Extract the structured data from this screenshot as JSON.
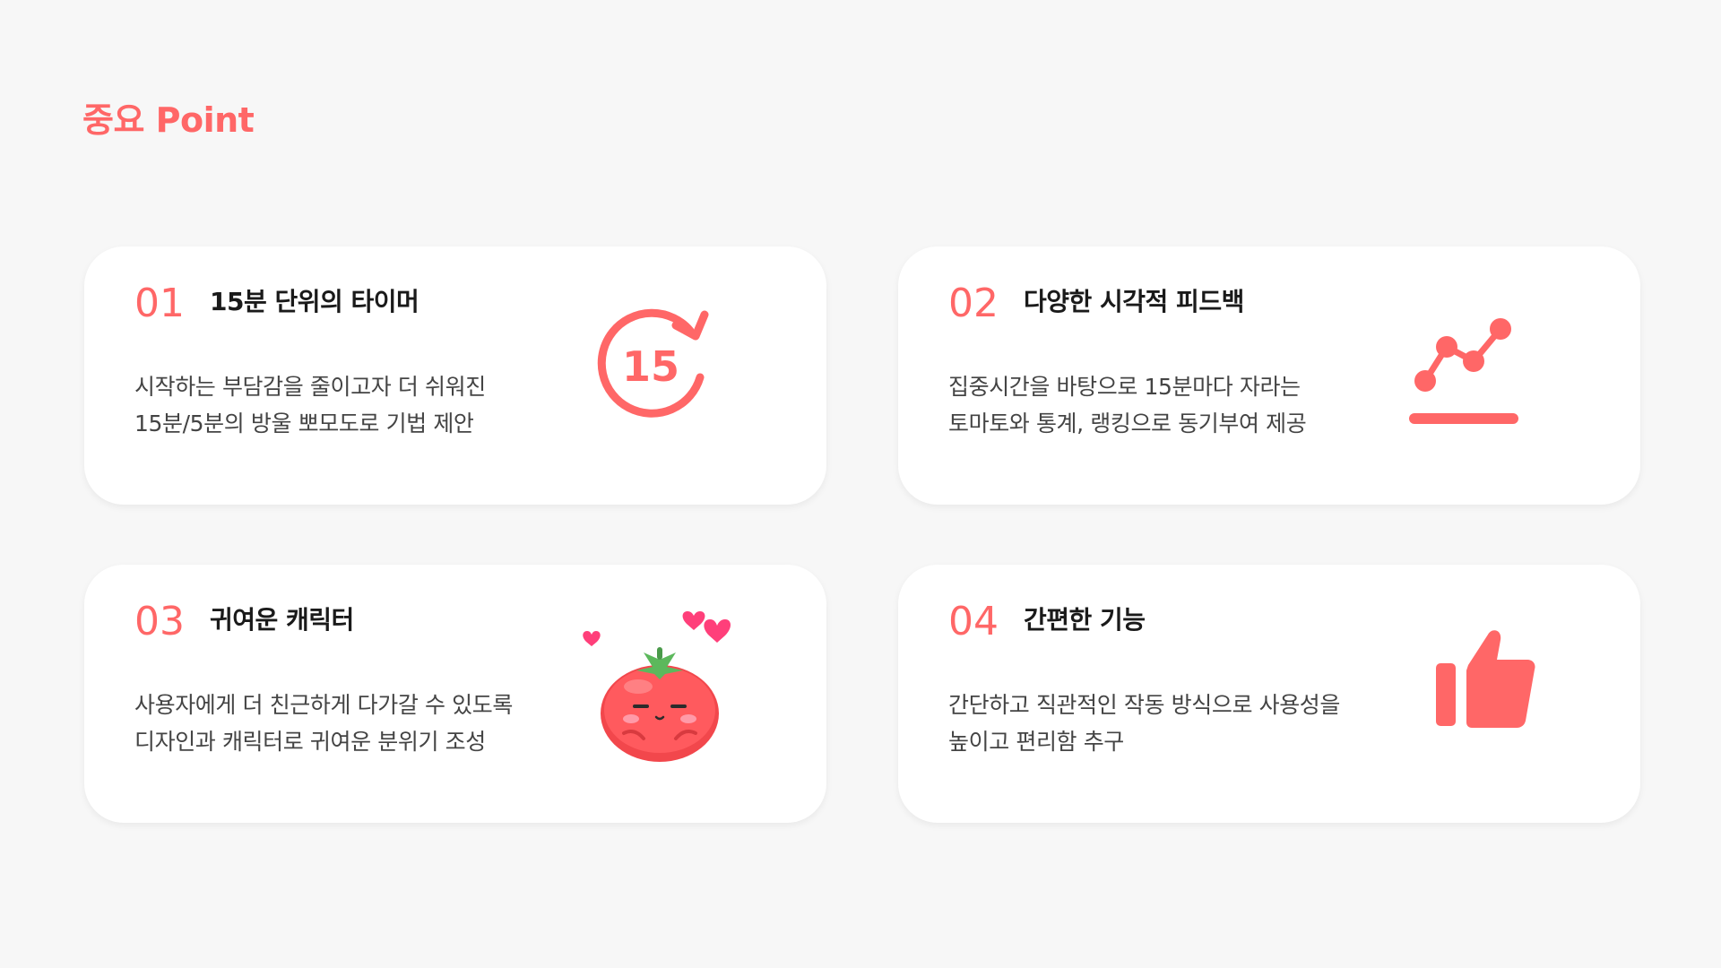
{
  "page": {
    "title": "중요 Point",
    "accent_color": "#ff6767"
  },
  "cards": [
    {
      "number": "01",
      "heading": "15분 단위의 타이머",
      "desc": [
        "시작하는 부담감을 줄이고자 더 쉬워진",
        "15분/5분의 방울 뽀모도로 기법 제안"
      ],
      "icon": "timer-15-icon",
      "icon_text": "15"
    },
    {
      "number": "02",
      "heading": "다양한 시각적 피드백",
      "desc": [
        "집중시간을 바탕으로 15분마다 자라는",
        "토마토와 통계, 랭킹으로 동기부여 제공"
      ],
      "icon": "line-chart-icon"
    },
    {
      "number": "03",
      "heading": "귀여운 캐릭터",
      "desc": [
        "사용자에게 더 친근하게 다가갈 수 있도록",
        "디자인과 캐릭터로 귀여운 분위기 조성"
      ],
      "icon": "tomato-character-icon"
    },
    {
      "number": "04",
      "heading": "간편한 기능",
      "desc": [
        "간단하고 직관적인 작동 방식으로 사용성을",
        "높이고 편리함 추구"
      ],
      "icon": "thumbs-up-icon"
    }
  ]
}
